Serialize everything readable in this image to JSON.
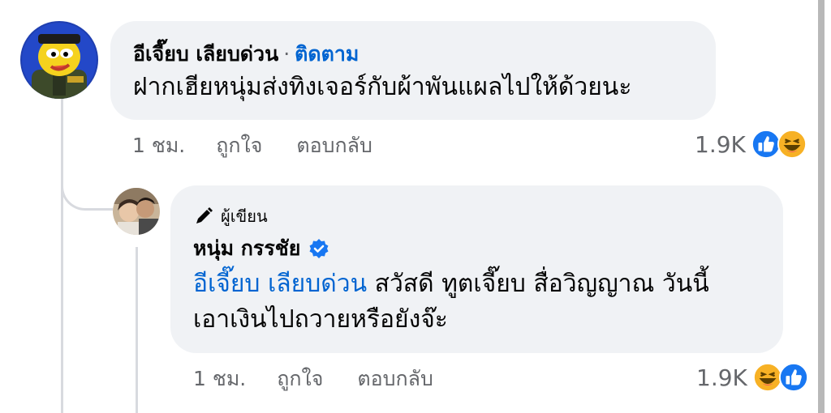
{
  "comment1": {
    "author": "อีเจี๊ยบ เลียบด่วน",
    "separator": "·",
    "follow_label": "ติดตาม",
    "text": "ฝากเฮียหนุ่มส่งทิงเจอร์กับผ้าพันแผลไปให้ด้วยนะ",
    "time": "1 ชม.",
    "like_label": "ถูกใจ",
    "reply_label": "ตอบกลับ",
    "reaction_count": "1.9K",
    "reactions": [
      "like-icon",
      "haha-icon"
    ]
  },
  "comment2": {
    "badge": "ผู้เขียน",
    "author": "หนุ่ม กรรชัย",
    "verified": true,
    "mention": "อีเจี๊ยบ เลียบด่วน",
    "text_line1": " สวัสดี ทูตเจี๊ยบ สื่อวิญญาณ วันนี้",
    "text_line2": "เอาเงินไปถวายหรือยังจ๊ะ",
    "time": "1 ชม.",
    "like_label": "ถูกใจ",
    "reply_label": "ตอบกลับ",
    "reaction_count": "1.9K",
    "reactions": [
      "haha-icon",
      "like-icon"
    ]
  },
  "colors": {
    "bubble": "#f0f2f5",
    "link": "#0064d1",
    "muted": "#65676b",
    "like_blue": "#1877f2",
    "haha_yellow": "#f7b125"
  }
}
